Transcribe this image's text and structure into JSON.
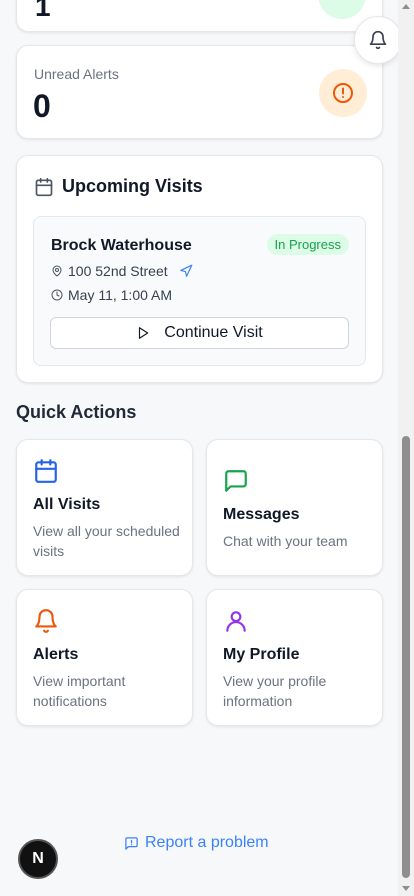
{
  "stats": {
    "top_value": "1",
    "unread_alerts_label": "Unread Alerts",
    "unread_alerts_value": "0"
  },
  "upcoming": {
    "title": "Upcoming Visits",
    "visit": {
      "name": "Brock Waterhouse",
      "status": "In Progress",
      "address": "100 52nd Street",
      "datetime": "May 11, 1:00 AM",
      "action_label": "Continue Visit"
    }
  },
  "quick_actions": {
    "title": "Quick Actions",
    "items": [
      {
        "title": "All Visits",
        "desc": "View all your scheduled visits",
        "icon": "calendar-icon",
        "color": "#2563eb"
      },
      {
        "title": "Messages",
        "desc": "Chat with your team",
        "icon": "message-icon",
        "color": "#16a34a"
      },
      {
        "title": "Alerts",
        "desc": "View important notifications",
        "icon": "bell-icon",
        "color": "#ea580c"
      },
      {
        "title": "My Profile",
        "desc": "View your profile information",
        "icon": "user-icon",
        "color": "#9333ea"
      }
    ]
  },
  "footer": {
    "report_label": "Report a problem",
    "badge_letter": "N"
  },
  "colors": {
    "alert_orange": "#ea580c",
    "success_green": "#16a34a",
    "link_blue": "#3b82f6"
  }
}
